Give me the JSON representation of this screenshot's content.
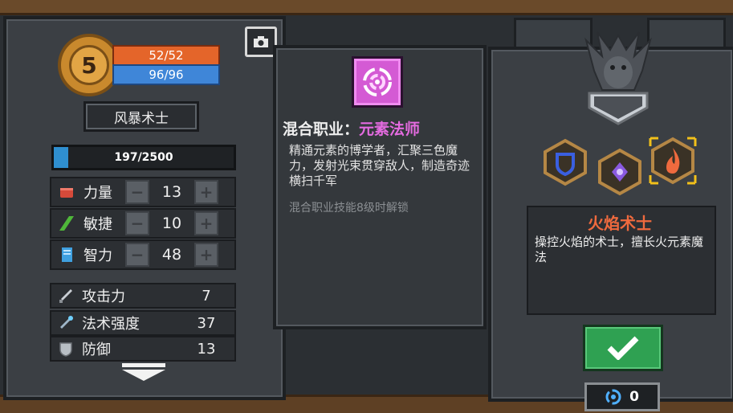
{
  "player": {
    "level": "5",
    "hp": "52/52",
    "mp": "96/96",
    "class_name": "风暴术士",
    "xp_text": "197/2500",
    "xp_fraction": 0.079
  },
  "stats": [
    {
      "label": "力量",
      "value": "13",
      "icon": "fist-icon"
    },
    {
      "label": "敏捷",
      "value": "10",
      "icon": "boot-icon"
    },
    {
      "label": "智力",
      "value": "48",
      "icon": "book-icon"
    }
  ],
  "attributes": [
    {
      "label": "攻击力",
      "value": "7",
      "icon": "sword-icon"
    },
    {
      "label": "法术强度",
      "value": "37",
      "icon": "wand-icon"
    },
    {
      "label": "防御",
      "value": "13",
      "icon": "shield-icon"
    }
  ],
  "hybrid": {
    "title_prefix": "混合职业：",
    "title_name": "元素法师",
    "description": "精通元素的博学者，汇聚三色魔力，发射光束贯穿敌人，制造奇迹横扫千军",
    "unlock_note": "混合职业技能8级时解锁"
  },
  "job": {
    "title": "火焰术士",
    "description": "操控火焰的术士，擅长火元素魔法"
  },
  "currency": {
    "amount": "0"
  },
  "colors": {
    "hp": "#e4652a",
    "mp": "#3f86d8",
    "accent_pink": "#e46be0",
    "job_title": "#ef6a3e",
    "confirm": "#2fa152",
    "hex_selected": "#f2c01a"
  }
}
